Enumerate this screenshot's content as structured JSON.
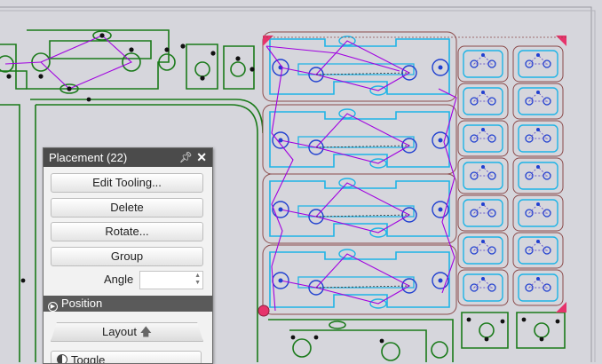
{
  "panel": {
    "title": "Placement (22)",
    "pin_icon": "pin-icon",
    "close_icon": "close-icon",
    "buttons": {
      "edit_tooling": "Edit Tooling...",
      "delete": "Delete",
      "rotate": "Rotate...",
      "group": "Group"
    },
    "angle_label": "Angle",
    "angle_value": "",
    "position_section": "Position",
    "layout_label": "Layout",
    "toggle_label": "Toggle"
  },
  "colors": {
    "background": "#d6d6dc",
    "part_outline": "#1a7a1a",
    "tool_path": "#1eb4e6",
    "boundary": "#8b4a4a",
    "rapid": "#a000e0",
    "marker": "#e6336b"
  }
}
